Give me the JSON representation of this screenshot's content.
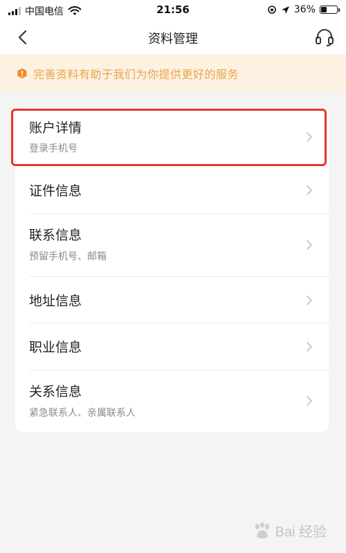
{
  "status_bar": {
    "carrier": "中国电信",
    "time": "21:56",
    "battery": "36%",
    "battery_level": 0.36,
    "icons": [
      "signal-icon",
      "wifi-icon",
      "orientation-lock-icon",
      "location-icon",
      "battery-icon"
    ]
  },
  "nav": {
    "title": "资料管理",
    "icons": [
      "back-arrow-icon",
      "headset-icon"
    ]
  },
  "notice": {
    "text": "完善资料有助于我们为你提供更好的服务",
    "icon": "warning-shield-icon",
    "color": "#e9a54b"
  },
  "menu": {
    "items": [
      {
        "title": "账户详情",
        "subtitle": "登录手机号"
      },
      {
        "title": "证件信息",
        "subtitle": ""
      },
      {
        "title": "联系信息",
        "subtitle": "预留手机号、邮箱"
      },
      {
        "title": "地址信息",
        "subtitle": ""
      },
      {
        "title": "职业信息",
        "subtitle": ""
      },
      {
        "title": "关系信息",
        "subtitle": "紧急联系人、亲属联系人"
      }
    ]
  },
  "colors": {
    "highlight": "#e8342f",
    "background": "#f4f4f4"
  },
  "watermark": {
    "text": "Bai  经验"
  }
}
